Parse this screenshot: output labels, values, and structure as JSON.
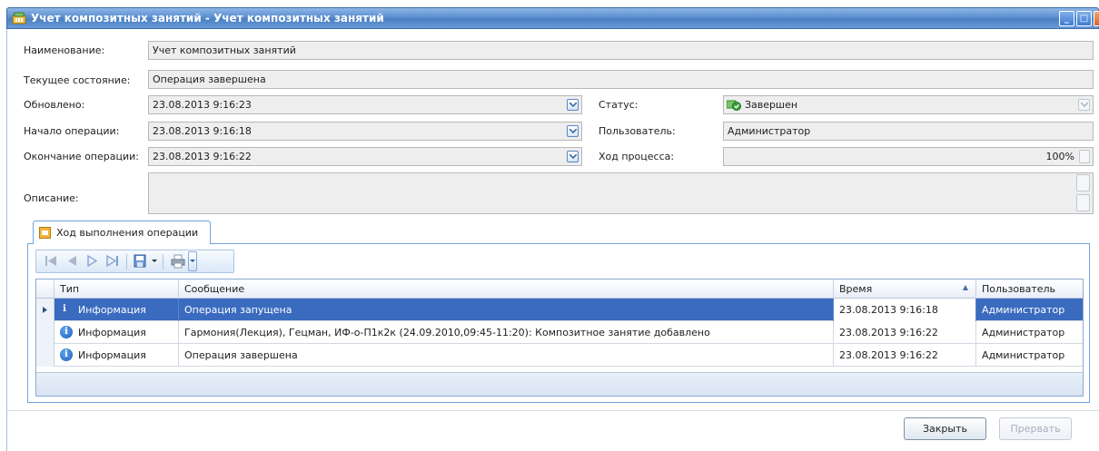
{
  "window": {
    "title": "Учет композитных занятий - Учет композитных занятий",
    "minimize": "_",
    "maximize": "□",
    "close": "✕"
  },
  "form": {
    "name_label": "Наименование:",
    "name_value": "Учет композитных занятий",
    "state_label": "Текущее состояние:",
    "state_value": "Операция завершена",
    "updated_label": "Обновлено:",
    "updated_value": "23.08.2013 9:16:23",
    "start_label": "Начало операции:",
    "start_value": "23.08.2013 9:16:18",
    "end_label": "Окончание операции:",
    "end_value": "23.08.2013 9:16:22",
    "status_label": "Статус:",
    "status_value": "Завершен",
    "user_label": "Пользователь:",
    "user_value": "Администратор",
    "progress_label": "Ход процесса:",
    "progress_value": "100%",
    "description_label": "Описание:",
    "description_value": ""
  },
  "tab": {
    "label": "Ход выполнения операции"
  },
  "grid": {
    "columns": [
      "Тип",
      "Сообщение",
      "Время",
      "Пользователь"
    ],
    "sort_indicator": "▲",
    "rows": [
      {
        "type": "Информация",
        "message": "Операция запущена",
        "time": "23.08.2013 9:16:18",
        "user": "Администратор"
      },
      {
        "type": "Информация",
        "message": "Гармония(Лекция), Гецман, ИФ-о-П1к2к (24.09.2010,09:45-11:20): Композитное занятие добавлено",
        "time": "23.08.2013 9:16:22",
        "user": "Администратор"
      },
      {
        "type": "Информация",
        "message": "Операция завершена",
        "time": "23.08.2013 9:16:22",
        "user": "Администратор"
      }
    ]
  },
  "buttons": {
    "close": "Закрыть",
    "abort": "Прервать"
  },
  "colors": {
    "title_bar": "#5a8fd0",
    "selection": "#3a6bbf",
    "status_icon": "#4caf50"
  }
}
